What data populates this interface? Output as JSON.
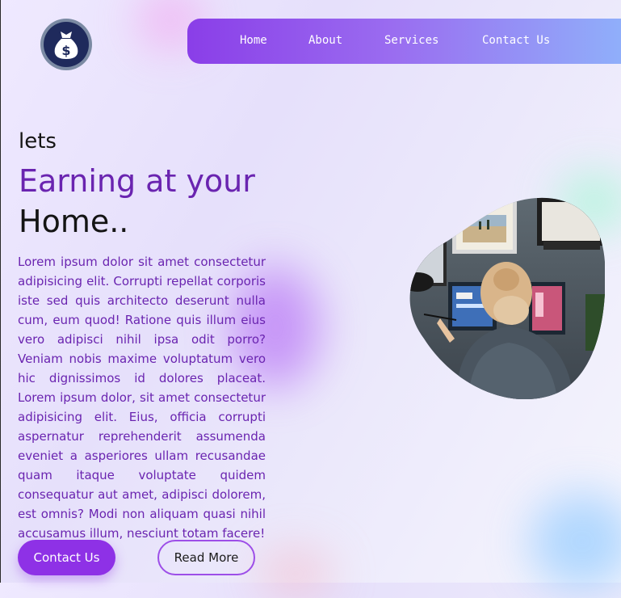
{
  "brand": {
    "logo_icon": "money-bag-icon",
    "logo_color": "#1f2a5c"
  },
  "nav": {
    "items": [
      {
        "label": "Home"
      },
      {
        "label": "About"
      },
      {
        "label": "Services"
      },
      {
        "label": "Contact Us"
      }
    ],
    "gradient": [
      "#8a3ee8",
      "#8fb4fb"
    ]
  },
  "hero": {
    "pre_title": "lets",
    "title_line1": "Earning at your",
    "title_line2": "Home..",
    "body": "Lorem ipsum dolor sit amet consectetur adipisicing elit. Corrupti repellat corporis iste sed quis architecto deserunt nulla cum, eum quod! Ratione quis illum eius vero adipisci nihil ipsa odit porro? Veniam nobis maxime voluptatum vero hic dignissimos id dolores placeat. Lorem ipsum dolor, sit amet consectetur adipisicing elit. Eius, officia corrupti aspernatur reprehenderit assumenda eveniet a asperiores ullam recusandae quam itaque voluptate quidem consequatur aut amet, adipisci dolorem, est omnis? Modi non aliquam quasi nihil accusamus illum, nesciunt totam facere!",
    "primary_button": "Contact Us",
    "secondary_button": "Read More",
    "accent_color": "#8e31e6",
    "image_subject": "woman-working-at-computer"
  }
}
